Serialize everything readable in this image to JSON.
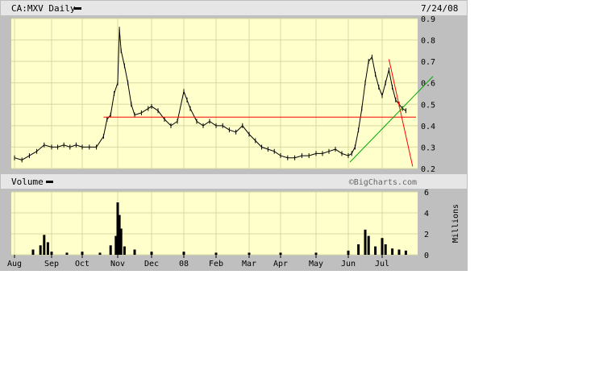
{
  "header": {
    "ticker_label": "CA:MXV Daily",
    "date": "7/24/08"
  },
  "volume_panel": {
    "label": "Volume",
    "watermark": "©BigCharts.com",
    "unit_label": "Millions"
  },
  "colors": {
    "plot_bg": "#ffffcc",
    "grid": "#d8d8a0",
    "frame_bg": "#cccccc",
    "header_bg": "#e6e6e6",
    "price": "#000000",
    "resistance_line": "#ff0000",
    "trend_line_down": "#ff0000",
    "trend_line_up": "#00aa00"
  },
  "chart_data": [
    {
      "type": "line",
      "title": "CA:MXV Daily",
      "x_categories": [
        "Aug",
        "Sep",
        "Oct",
        "Nov",
        "Dec",
        "08",
        "Feb",
        "Mar",
        "Apr",
        "May",
        "Jun",
        "Jul"
      ],
      "ylim": [
        0.2,
        0.9
      ],
      "yticks": [
        0.2,
        0.3,
        0.4,
        0.5,
        0.6,
        0.7,
        0.8,
        0.9
      ],
      "grid": true,
      "series": [
        {
          "values_by_x_index": [
            [
              0.0,
              0.25
            ],
            [
              0.2,
              0.24
            ],
            [
              0.4,
              0.26
            ],
            [
              0.6,
              0.28
            ],
            [
              0.8,
              0.31
            ],
            [
              1.0,
              0.3
            ],
            [
              1.2,
              0.3
            ],
            [
              1.4,
              0.31
            ],
            [
              1.6,
              0.3
            ],
            [
              1.8,
              0.31
            ],
            [
              2.0,
              0.3
            ],
            [
              2.2,
              0.3
            ],
            [
              2.4,
              0.3
            ],
            [
              2.6,
              0.35
            ],
            [
              2.7,
              0.43
            ],
            [
              2.8,
              0.45
            ],
            [
              2.9,
              0.55
            ],
            [
              3.0,
              0.6
            ],
            [
              3.05,
              0.85
            ],
            [
              3.1,
              0.75
            ],
            [
              3.2,
              0.68
            ],
            [
              3.3,
              0.6
            ],
            [
              3.4,
              0.5
            ],
            [
              3.5,
              0.45
            ],
            [
              3.7,
              0.46
            ],
            [
              3.9,
              0.48
            ],
            [
              4.0,
              0.49
            ],
            [
              4.2,
              0.47
            ],
            [
              4.4,
              0.43
            ],
            [
              4.6,
              0.4
            ],
            [
              4.8,
              0.42
            ],
            [
              5.0,
              0.56
            ],
            [
              5.1,
              0.52
            ],
            [
              5.2,
              0.48
            ],
            [
              5.4,
              0.42
            ],
            [
              5.6,
              0.4
            ],
            [
              5.8,
              0.42
            ],
            [
              6.0,
              0.4
            ],
            [
              6.2,
              0.4
            ],
            [
              6.4,
              0.38
            ],
            [
              6.6,
              0.37
            ],
            [
              6.8,
              0.4
            ],
            [
              7.0,
              0.36
            ],
            [
              7.2,
              0.33
            ],
            [
              7.4,
              0.3
            ],
            [
              7.6,
              0.29
            ],
            [
              7.8,
              0.28
            ],
            [
              8.0,
              0.26
            ],
            [
              8.2,
              0.25
            ],
            [
              8.4,
              0.25
            ],
            [
              8.6,
              0.26
            ],
            [
              8.8,
              0.26
            ],
            [
              9.0,
              0.27
            ],
            [
              9.2,
              0.27
            ],
            [
              9.4,
              0.28
            ],
            [
              9.6,
              0.29
            ],
            [
              9.8,
              0.27
            ],
            [
              10.0,
              0.26
            ],
            [
              10.1,
              0.27
            ],
            [
              10.2,
              0.3
            ],
            [
              10.3,
              0.38
            ],
            [
              10.4,
              0.48
            ],
            [
              10.5,
              0.6
            ],
            [
              10.6,
              0.7
            ],
            [
              10.7,
              0.72
            ],
            [
              10.8,
              0.64
            ],
            [
              10.9,
              0.58
            ],
            [
              11.0,
              0.54
            ],
            [
              11.1,
              0.6
            ],
            [
              11.2,
              0.66
            ],
            [
              11.3,
              0.58
            ],
            [
              11.4,
              0.52
            ],
            [
              11.5,
              0.5
            ],
            [
              11.6,
              0.48
            ],
            [
              11.7,
              0.47
            ]
          ]
        },
        {
          "name": "",
          "values_by_x_index": [
            [
              2.6,
              0.44
            ],
            [
              12.0,
              0.44
            ]
          ]
        },
        {
          "name": "",
          "values_by_x_index": [
            [
              11.2,
              0.71
            ],
            [
              11.9,
              0.21
            ]
          ]
        },
        {
          "name": "",
          "values_by_x_index": [
            [
              10.05,
              0.23
            ],
            [
              12.5,
              0.63
            ]
          ]
        }
      ]
    },
    {
      "type": "bar",
      "title": "Volume",
      "x_categories": [
        "Aug",
        "Sep",
        "Oct",
        "Nov",
        "Dec",
        "08",
        "Feb",
        "Mar",
        "Apr",
        "May",
        "Jun",
        "Jul"
      ],
      "ylabel": "Millions",
      "ylim": [
        0,
        6
      ],
      "yticks": [
        0,
        2,
        4,
        6
      ],
      "grid": true,
      "series": [
        {
          "values_by_x_index": [
            [
              0.5,
              0.5
            ],
            [
              0.7,
              0.9
            ],
            [
              0.8,
              1.9
            ],
            [
              0.9,
              1.2
            ],
            [
              1.0,
              0.3
            ],
            [
              1.5,
              0.2
            ],
            [
              2.0,
              0.3
            ],
            [
              2.5,
              0.2
            ],
            [
              2.8,
              0.9
            ],
            [
              2.95,
              1.8
            ],
            [
              3.0,
              5.0
            ],
            [
              3.05,
              3.8
            ],
            [
              3.1,
              2.5
            ],
            [
              3.2,
              0.8
            ],
            [
              3.5,
              0.5
            ],
            [
              4.0,
              0.3
            ],
            [
              5.0,
              0.3
            ],
            [
              6.0,
              0.2
            ],
            [
              7.0,
              0.2
            ],
            [
              8.0,
              0.2
            ],
            [
              9.0,
              0.2
            ],
            [
              10.0,
              0.4
            ],
            [
              10.3,
              1.0
            ],
            [
              10.5,
              2.4
            ],
            [
              10.6,
              1.8
            ],
            [
              10.8,
              0.8
            ],
            [
              11.0,
              1.6
            ],
            [
              11.1,
              1.0
            ],
            [
              11.3,
              0.6
            ],
            [
              11.5,
              0.5
            ],
            [
              11.7,
              0.4
            ]
          ]
        }
      ]
    }
  ]
}
